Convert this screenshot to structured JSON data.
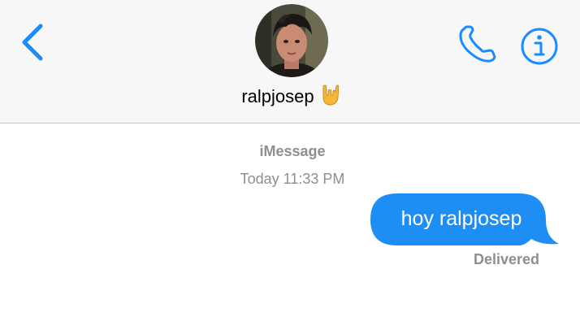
{
  "conversation": {
    "contact_name": "ralpjosep",
    "contact_emoji_icon": "sign-of-the-horns-emoji",
    "service_label": "iMessage",
    "timestamp": "Today 11:33 PM"
  },
  "messages": [
    {
      "direction": "outgoing",
      "text": "hoy ralpjosep",
      "status": "Delivered"
    }
  ],
  "icons": {
    "back": "chevron-left-icon",
    "call": "phone-icon",
    "info": "info-icon"
  },
  "colors": {
    "accent": "#1a8cff",
    "bubble": "#1e8ef5",
    "secondary_text": "#8e8e93",
    "header_bg": "#f7f7f7"
  }
}
